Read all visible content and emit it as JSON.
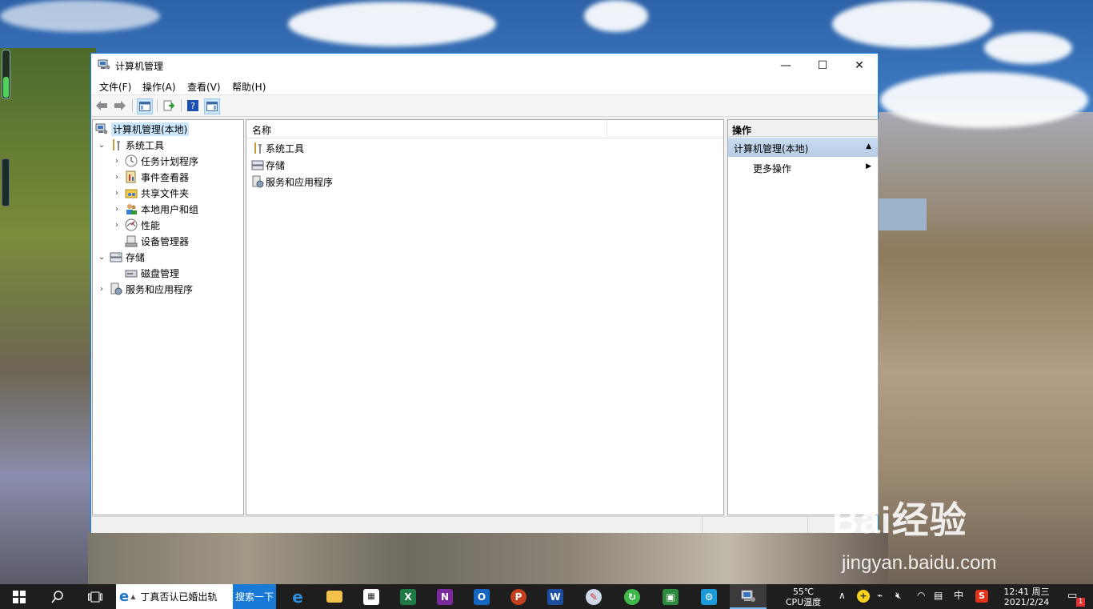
{
  "window": {
    "title": "计算机管理",
    "controls": {
      "minimize": "—",
      "maximize": "☐",
      "close": "✕"
    }
  },
  "menu": [
    "文件(F)",
    "操作(A)",
    "查看(V)",
    "帮助(H)"
  ],
  "tree": {
    "root": "计算机管理(本地)",
    "system_tools": "系统工具",
    "task_scheduler": "任务计划程序",
    "event_viewer": "事件查看器",
    "shared_folders": "共享文件夹",
    "local_users": "本地用户和组",
    "performance": "性能",
    "device_manager": "设备管理器",
    "storage": "存储",
    "disk_management": "磁盘管理",
    "services_apps": "服务和应用程序"
  },
  "list": {
    "column_name": "名称",
    "rows": [
      "系统工具",
      "存储",
      "服务和应用程序"
    ]
  },
  "actions": {
    "header": "操作",
    "group": "计算机管理(本地)",
    "more": "更多操作"
  },
  "taskbar": {
    "search_text": "丁真否认已婚出轨",
    "search_button": "搜索一下",
    "temperature": "55℃",
    "temperature_label": "CPU温度",
    "ime": "中",
    "time": "12:41 周三",
    "date": "2021/2/24",
    "notification_count": "1"
  },
  "watermark": {
    "brand": "Bai经验",
    "url": "jingyan.baidu.com"
  }
}
